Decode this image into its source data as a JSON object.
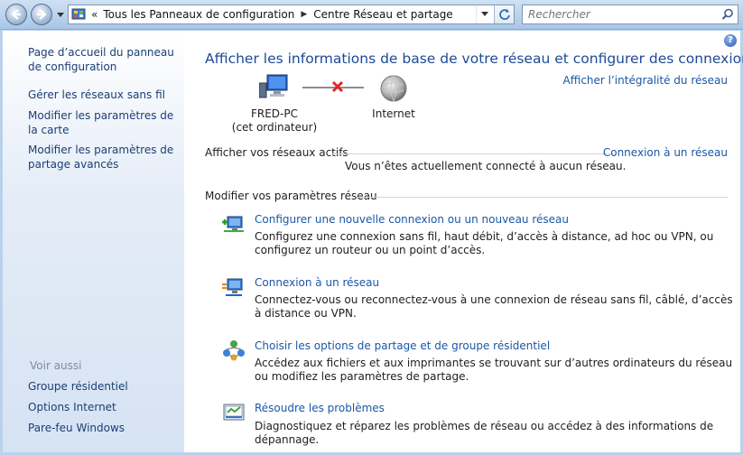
{
  "window": {
    "breadcrumb": [
      "Tous les Panneaux de configuration",
      "Centre Réseau et partage"
    ],
    "search_placeholder": "Rechercher"
  },
  "sidebar": {
    "items": [
      {
        "label": "Page d’accueil du panneau de configuration"
      },
      {
        "label": "Gérer les réseaux sans fil"
      },
      {
        "label": "Modifier les paramètres de la carte"
      },
      {
        "label": "Modifier les paramètres de partage avancés"
      }
    ],
    "see_also_label": "Voir aussi",
    "see_also": [
      {
        "label": "Groupe résidentiel"
      },
      {
        "label": "Options Internet"
      },
      {
        "label": "Pare-feu Windows"
      }
    ]
  },
  "main": {
    "title": "Afficher les informations de base de votre réseau et configurer des connexions",
    "full_map_link": "Afficher l’intégralité du réseau",
    "map": {
      "computer_name": "FRED-PC",
      "computer_sub": "(cet ordinateur)",
      "internet_label": "Internet",
      "status": "disconnected"
    },
    "active_networks": {
      "header": "Afficher vos réseaux actifs",
      "connect_link": "Connexion à un réseau",
      "message": "Vous n’êtes actuellement connecté à aucun réseau."
    },
    "settings": {
      "header": "Modifier vos paramètres réseau",
      "tasks": [
        {
          "icon": "new-connection-icon",
          "label": "Configurer une nouvelle connexion ou un nouveau réseau",
          "desc": "Configurez une connexion sans fil, haut débit, d’accès à distance, ad hoc ou VPN, ou configurez un routeur ou un point d’accès."
        },
        {
          "icon": "connect-network-icon",
          "label": "Connexion à un réseau",
          "desc": "Connectez-vous ou reconnectez-vous à une connexion de réseau sans fil, câblé, d’accès à distance ou VPN."
        },
        {
          "icon": "homegroup-sharing-icon",
          "label": "Choisir les options de partage et de groupe résidentiel",
          "desc": "Accédez aux fichiers et aux imprimantes se trouvant sur d’autres ordinateurs du réseau ou modifiez les paramètres de partage."
        },
        {
          "icon": "troubleshoot-icon",
          "label": "Résoudre les problèmes",
          "desc": "Diagnostiquez et réparez les problèmes de réseau ou accédez à des informations de dépannage."
        }
      ]
    }
  },
  "colors": {
    "link": "#1b57a8",
    "title": "#1c4a97",
    "sidebar_link": "#1b3f73",
    "frame": "#b9d1ea"
  }
}
